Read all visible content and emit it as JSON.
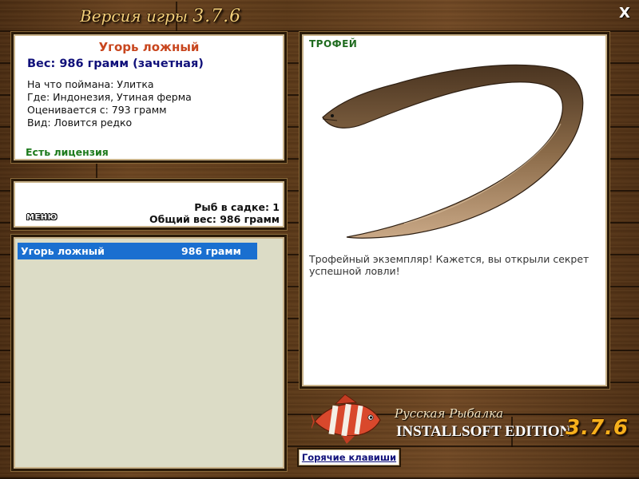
{
  "window": {
    "title_prefix": "Версия игры",
    "title_version": "3.7.6",
    "close_label": "X"
  },
  "fish_info": {
    "name": "Угорь ложный",
    "weight": "Вес: 986 грамм (зачетная)",
    "bait": "На что поймана: Улитка",
    "location": "Где: Индонезия, Утиная ферма",
    "rated_from": "Оценивается с: 793 грамм",
    "species": "Вид: Ловится редко",
    "license": "Есть лицензия"
  },
  "catch_summary": {
    "menu_label": "МЕНЮ",
    "fish_count": "Рыб в садке: 1",
    "total_weight": "Общий вес: 986 грамм"
  },
  "catch_list": [
    {
      "name": "Угорь ложный",
      "weight": "986 грамм"
    }
  ],
  "trophy": {
    "label": "ТРОФЕЙ",
    "message": "Трофейный экземпляр! Кажется, вы открыли секрет успешной ловли!"
  },
  "branding": {
    "line1": "Русская Рыбалка",
    "line2": "INSTALLSOFT EDITION",
    "version": "3.7.6"
  },
  "footer": {
    "hotkeys_label": "Горячие клавиши"
  },
  "icons": {
    "close": "close-icon",
    "fish_image": "eel-image",
    "brand_fish": "striped-fish-icon"
  },
  "colors": {
    "title_gold": "#f2cf7a",
    "fish_name": "#c8461e",
    "weight_blue": "#10107a",
    "license_green": "#1c7a1c",
    "selection_blue": "#1a6fd0",
    "trophy_green": "#1f6b1f",
    "version_orange": "#f6b01c",
    "wood": "#5a3818"
  }
}
